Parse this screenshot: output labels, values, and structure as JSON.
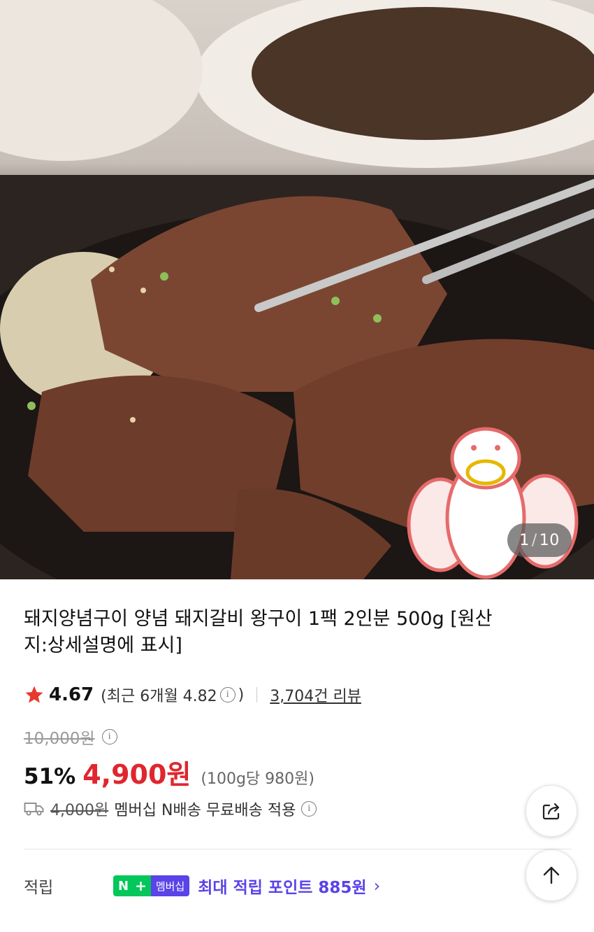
{
  "gallery": {
    "current": "1",
    "separator": "/",
    "total": "10"
  },
  "product": {
    "title": "돼지양념구이 양념 돼지갈비 왕구이 1팩 2인분 500g [원산지:상세설명에 표시]"
  },
  "rating": {
    "icon": "star-icon",
    "score": "4.67",
    "recent_text": "(최근 6개월 4.82",
    "recent_close": ")",
    "reviews": "3,704건 리뷰"
  },
  "price": {
    "original": "10,000원",
    "discount": "51%",
    "sale": "4,900원",
    "unit_price": "(100g당 980원)",
    "sale_color": "#e0262e"
  },
  "shipping": {
    "icon": "truck-icon",
    "fee": "4,000원",
    "note": "멤버십 N배송 무료배송 적용"
  },
  "points": {
    "label": "적립",
    "badge_n": "N",
    "badge_plus": "+",
    "badge_membership": "멤버십",
    "text": "최대 적립 포인트 885원",
    "accent": "#5a43e8",
    "green": "#03c75a"
  },
  "buttons": {
    "share_icon": "share-icon",
    "top_icon": "arrow-up-icon"
  }
}
